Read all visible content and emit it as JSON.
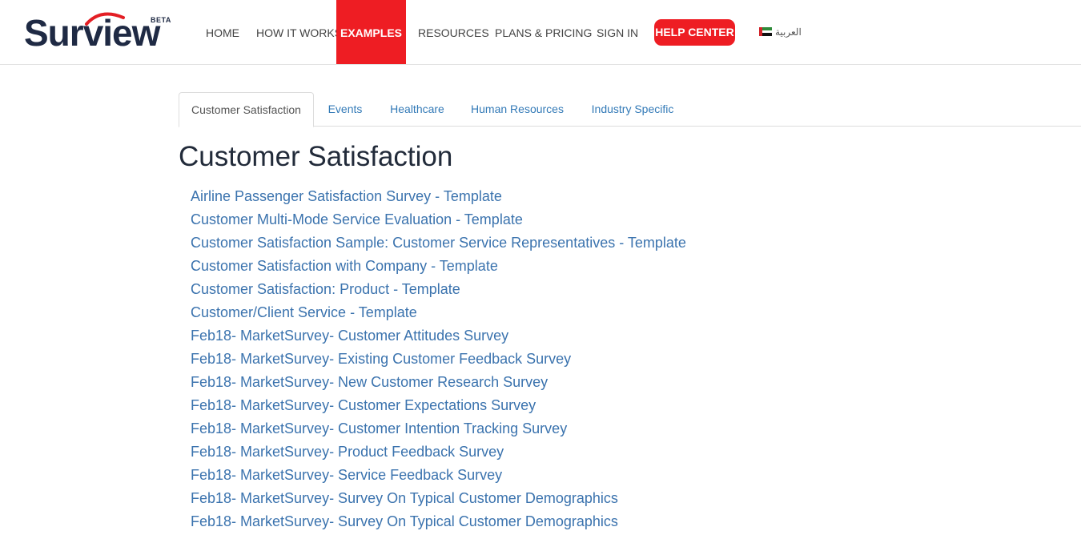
{
  "brand": {
    "name_part1": "Sur",
    "name_part2": "view",
    "badge": "BETA",
    "colors": {
      "navy": "#1f2a44",
      "red": "#ee1d23"
    }
  },
  "nav": {
    "items": [
      {
        "label": "HOME"
      },
      {
        "label": "HOW IT WORKS"
      },
      {
        "label": "EXAMPLES",
        "active": true
      },
      {
        "label": "RESOURCES"
      },
      {
        "label": "PLANS & PRICING"
      },
      {
        "label": "SIGN IN"
      }
    ],
    "help_center": "HELP CENTER",
    "language": "العربية",
    "language_icon": "uae-flag-icon"
  },
  "tabs": [
    {
      "label": "Customer Satisfaction",
      "active": true
    },
    {
      "label": "Events"
    },
    {
      "label": "Healthcare"
    },
    {
      "label": "Human Resources"
    },
    {
      "label": "Industry Specific"
    }
  ],
  "main": {
    "title": "Customer Satisfaction",
    "links": [
      "Airline Passenger Satisfaction Survey - Template",
      "Customer Multi-Mode Service Evaluation - Template",
      "Customer Satisfaction Sample: Customer Service Representatives - Template",
      "Customer Satisfaction with Company - Template",
      "Customer Satisfaction: Product - Template",
      "Customer/Client Service - Template",
      "Feb18- MarketSurvey- Customer Attitudes Survey",
      "Feb18- MarketSurvey- Existing Customer Feedback Survey",
      "Feb18- MarketSurvey- New Customer Research Survey",
      "Feb18- MarketSurvey- Customer Expectations Survey",
      "Feb18- MarketSurvey- Customer Intention Tracking Survey",
      "Feb18- MarketSurvey- Product Feedback Survey",
      "Feb18- MarketSurvey- Service Feedback Survey",
      "Feb18- MarketSurvey- Survey On Typical Customer Demographics",
      "Feb18- MarketSurvey- Survey On Typical Customer Demographics"
    ]
  }
}
